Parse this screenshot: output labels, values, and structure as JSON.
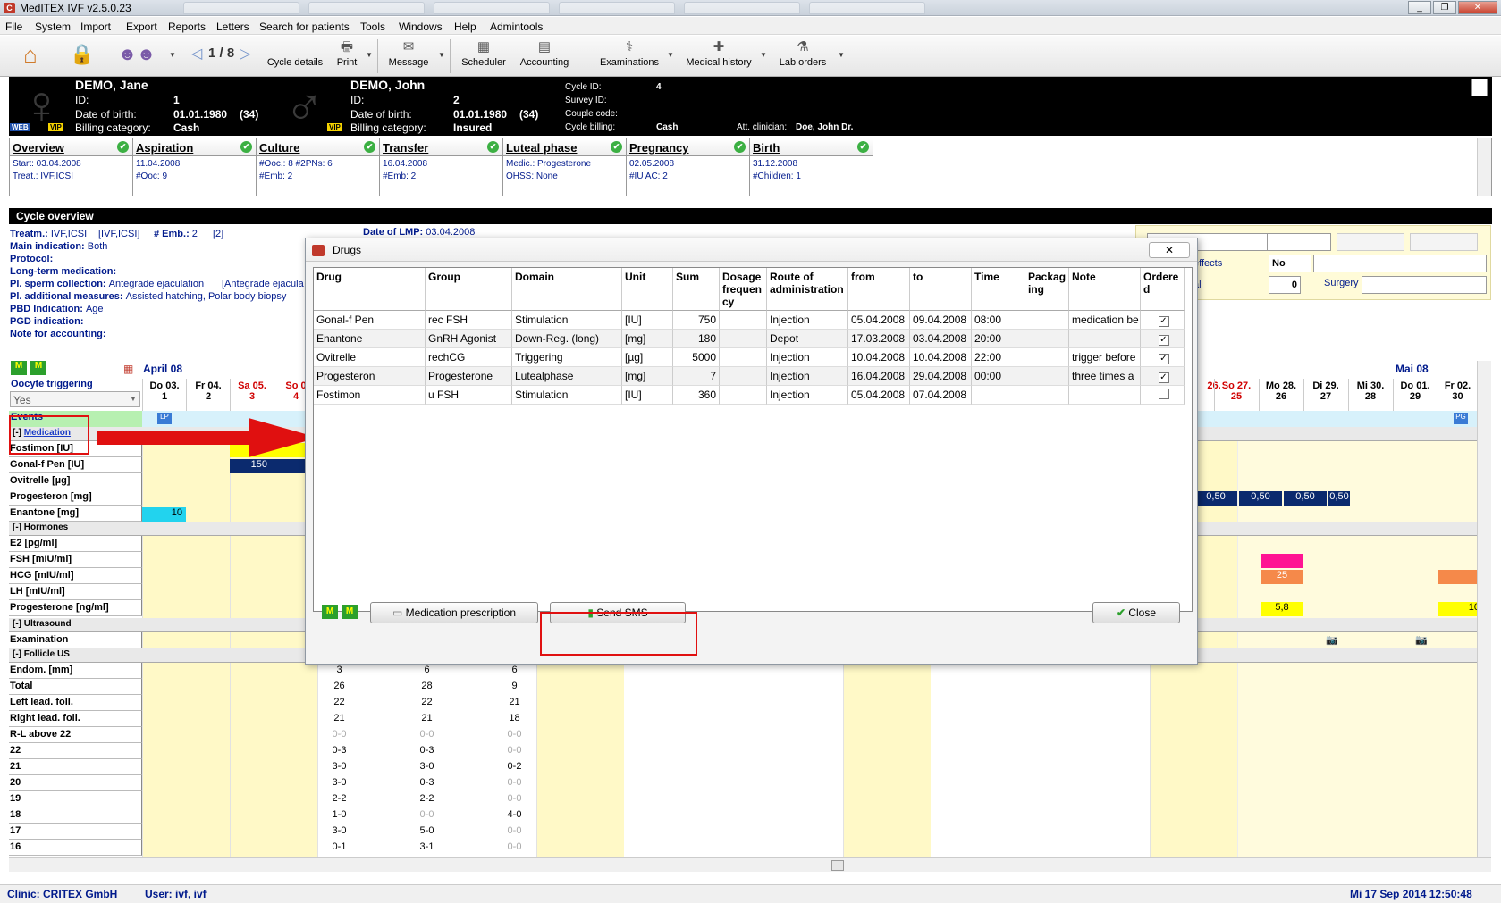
{
  "window": {
    "title": "MedITEX IVF v2.5.0.23"
  },
  "menu": [
    "File",
    "System",
    "Import",
    "Export",
    "Reports",
    "Letters",
    "Search for patients",
    "Tools",
    "Windows",
    "Help",
    "Admintools"
  ],
  "toolbar": {
    "pager": "1 / 8",
    "items": [
      "Cycle details",
      "Print",
      "Message",
      "Scheduler",
      "Accounting",
      "Examinations",
      "Medical history",
      "Lab orders"
    ]
  },
  "patient": {
    "female": {
      "name": "DEMO, Jane",
      "id_label": "ID:",
      "id": "1",
      "dob_label": "Date of birth:",
      "dob": "01.01.1980",
      "age": "(34)",
      "billing_label": "Billing category:",
      "billing": "Cash"
    },
    "male": {
      "name": "DEMO, John",
      "id_label": "ID:",
      "id": "2",
      "dob_label": "Date of birth:",
      "dob": "01.01.1980",
      "age": "(34)",
      "billing_label": "Billing category:",
      "billing": "Insured"
    },
    "cycle_id_label": "Cycle ID:",
    "cycle_id": "4",
    "survey_label": "Survey ID:",
    "couple_label": "Couple code:",
    "billing_label": "Cycle billing:",
    "billing": "Cash",
    "clinician_label": "Att. clinician:",
    "clinician": "Doe, John Dr.",
    "badges": {
      "web": "WEB",
      "vip": "VIP"
    }
  },
  "phases": [
    {
      "title": "Overview",
      "l1": "Start: 03.04.2008",
      "l2": "Treat.: IVF,ICSI"
    },
    {
      "title": "Aspiration",
      "l1": "11.04.2008",
      "l2": "#Ooc: 9"
    },
    {
      "title": "Culture",
      "l1": "#Ooc.: 8 #2PNs: 6",
      "l2": "#Emb: 2"
    },
    {
      "title": "Transfer",
      "l1": "16.04.2008",
      "l2": "#Emb: 2"
    },
    {
      "title": "Luteal phase",
      "l1": "Medic.: Progesterone",
      "l2": "OHSS: None"
    },
    {
      "title": "Pregnancy",
      "l1": "02.05.2008",
      "l2": "#IU AC:  2"
    },
    {
      "title": "Birth",
      "l1": "31.12.2008",
      "l2": "#Children: 1"
    }
  ],
  "overview": {
    "heading": "Cycle overview",
    "treatm_label": "Treatm.:",
    "treatm": "IVF,ICSI",
    "treatm2": "[IVF,ICSI]",
    "emb_label": "# Emb.:",
    "emb": "2",
    "emb2": "[2]",
    "lmp_label": "Date of LMP:",
    "lmp": "03.04.2008",
    "main_label": "Main indication:",
    "main": "Both",
    "protocol_label": "Protocol:",
    "ltm_label": "Long-term medication:",
    "sperm_label": "Pl. sperm collection:",
    "sperm": "Antegrade ejaculation",
    "sperm2": "[Antegrade ejacula",
    "addm_label": "Pl. additional measures:",
    "addm": "Assisted hatching, Polar body biopsy",
    "pbd_label": "PBD Indication:",
    "pbd": "Age",
    "pgd_label": "PGD indication:",
    "note_label": "Note for accounting:",
    "right_effects": "effects",
    "right_no": "No",
    "right_al": "al",
    "right_zero": "0",
    "right_surgery": "Surgery",
    "right_ne": "ne"
  },
  "calendar": {
    "month1": "April 08",
    "month2": "Mai 08",
    "trigger_label": "Oocyte triggering",
    "trigger_value": "Yes",
    "days_left": [
      {
        "d": "Do 03.",
        "n": "1",
        "red": false
      },
      {
        "d": "Fr 04.",
        "n": "2",
        "red": false
      },
      {
        "d": "Sa 05.",
        "n": "3",
        "red": true
      },
      {
        "d": "So 0",
        "n": "4",
        "red": true
      }
    ],
    "days_right": [
      {
        "d": "26.",
        "n": "",
        "red": true
      },
      {
        "d": "So 27.",
        "n": "25",
        "red": true
      },
      {
        "d": "Mo 28.",
        "n": "26",
        "red": false
      },
      {
        "d": "Di 29.",
        "n": "27",
        "red": false
      },
      {
        "d": "Mi 30.",
        "n": "28",
        "red": false
      },
      {
        "d": "Do 01.",
        "n": "29",
        "red": false
      },
      {
        "d": "Fr 02.",
        "n": "30",
        "red": false
      }
    ],
    "rows": {
      "events": "Events",
      "medication": "Medication",
      "fostimon": "Fostimon [IU]",
      "gonal": "Gonal-f Pen [IU]",
      "ovitrelle": "Ovitrelle [µg]",
      "progesteron": "Progesteron [mg]",
      "enantone": "Enantone [mg]",
      "hormones": "Hormones",
      "e2": "E2  [pg/ml]",
      "fsh": "FSH  [mIU/ml]",
      "hcg": "HCG  [mIU/ml]",
      "lh": "LH  [mIU/ml]",
      "progesterone": "Progesterone  [ng/ml]",
      "ultrasound": "Ultrasound",
      "examination": "Examination",
      "follicle": "Follicle US",
      "endom": "Endom. [mm]",
      "total": "Total",
      "left": "Left lead. foll.",
      "right": "Right lead. foll.",
      "rl": "R-L above 22",
      "f22": "22",
      "f21": "21",
      "f20": "20",
      "f19": "19",
      "f18": "18",
      "f17": "17",
      "f16": "16"
    },
    "cells": {
      "fost": "120",
      "gonal": "150",
      "enant": "10",
      "prog": [
        "0,50",
        "0,50",
        "0,50",
        "0,50"
      ],
      "fsh": "25",
      "hcg": "5,8",
      "hcg2": "10,"
    },
    "follicle_values": {
      "c1": [
        "3",
        "26",
        "22",
        "21",
        "0-0",
        "0-3",
        "3-0",
        "3-0",
        "2-2",
        "1-0",
        "3-0",
        "0-1"
      ],
      "c2": [
        "6",
        "28",
        "22",
        "21",
        "0-0",
        "0-3",
        "3-0",
        "0-3",
        "2-2",
        "0-0",
        "5-0",
        "3-1"
      ],
      "c3": [
        "6",
        "9",
        "21",
        "18",
        "0-0",
        "0-0",
        "0-2",
        "0-0",
        "0-0",
        "4-0",
        "0-0",
        "0-0"
      ]
    }
  },
  "drugs_dialog": {
    "title": "Drugs",
    "columns": [
      "Drug",
      "Group",
      "Domain",
      "Unit",
      "Sum",
      "Dosage frequency",
      "Route of administration",
      "from",
      "to",
      "Time",
      "Packaging",
      "Note",
      "Ordered"
    ],
    "rows": [
      {
        "drug": "Gonal-f Pen",
        "group": "rec FSH",
        "domain": "Stimulation",
        "unit": "[IU]",
        "sum": "750",
        "freq": "",
        "route": "Injection",
        "from": "05.04.2008",
        "to": "09.04.2008",
        "time": "08:00",
        "pack": "",
        "note": "medication be",
        "ordered": true
      },
      {
        "drug": "Enantone",
        "group": "GnRH Agonist",
        "domain": "Down-Reg. (long)",
        "unit": "[mg]",
        "sum": "180",
        "freq": "",
        "route": "Depot",
        "from": "17.03.2008",
        "to": "03.04.2008",
        "time": "20:00",
        "pack": "",
        "note": "",
        "ordered": true
      },
      {
        "drug": "Ovitrelle",
        "group": "rechCG",
        "domain": "Triggering",
        "unit": "[µg]",
        "sum": "5000",
        "freq": "",
        "route": "Injection",
        "from": "10.04.2008",
        "to": "10.04.2008",
        "time": "22:00",
        "pack": "",
        "note": "trigger before",
        "ordered": true
      },
      {
        "drug": "Progesteron",
        "group": "Progesterone",
        "domain": "Lutealphase",
        "unit": "[mg]",
        "sum": "7",
        "freq": "",
        "route": "Injection",
        "from": "16.04.2008",
        "to": "29.04.2008",
        "time": "00:00",
        "pack": "",
        "note": "three times a",
        "ordered": true
      },
      {
        "drug": "Fostimon",
        "group": "u FSH",
        "domain": "Stimulation",
        "unit": "[IU]",
        "sum": "360",
        "freq": "",
        "route": "Injection",
        "from": "05.04.2008",
        "to": "07.04.2008",
        "time": "",
        "pack": "",
        "note": "",
        "ordered": false
      }
    ],
    "buttons": {
      "prescription": "Medication prescription",
      "sms": "Send SMS",
      "close": "Close"
    }
  },
  "status": {
    "clinic": "Clinic: CRITEX GmbH",
    "user": "User: ivf, ivf",
    "datetime": "Mi 17 Sep 2014 12:50:48"
  },
  "colors": {
    "accent_red": "#e01010",
    "check_green": "#3cb043",
    "label_blue": "#001a8c",
    "weekend_yellow": "#fff9c7",
    "navy_cell": "#0b2a6e",
    "cyan_cell": "#22d3ee",
    "pink_cell": "#ff1493",
    "orange_cell": "#f5894a",
    "yellow_cell": "#ffff00"
  }
}
